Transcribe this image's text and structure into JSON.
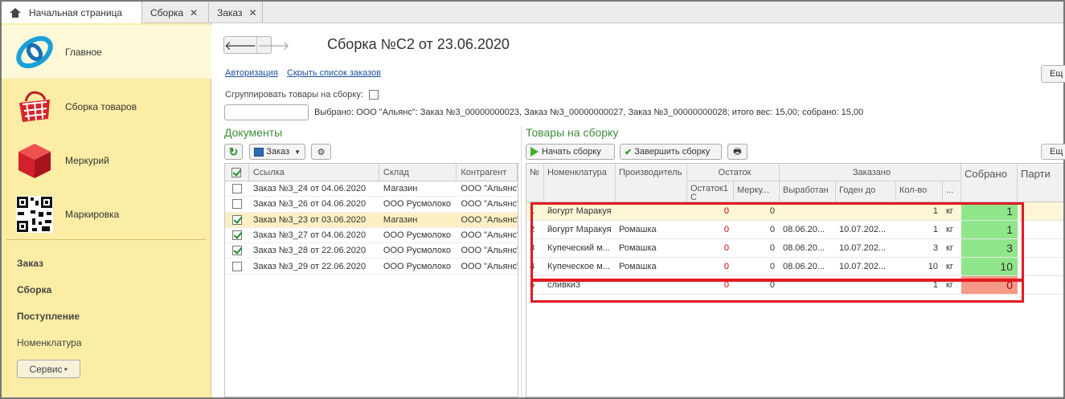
{
  "tabs": [
    {
      "label": "Начальная страница",
      "closable": false
    },
    {
      "label": "Сборка",
      "closable": true
    },
    {
      "label": "Заказ",
      "closable": true
    }
  ],
  "sidebar": {
    "items": [
      {
        "label": "Главное",
        "icon": "logo-icon"
      },
      {
        "label": "Сборка товаров",
        "icon": "basket-icon"
      },
      {
        "label": "Меркурий",
        "icon": "cube-icon"
      },
      {
        "label": "Маркировка",
        "icon": "qr-code-icon"
      }
    ],
    "links": [
      "Заказ",
      "Сборка",
      "Поступление",
      "Номенклатура"
    ],
    "service_label": "Сервис"
  },
  "header": {
    "title": "Сборка №С2 от 23.06.2020",
    "link_auth": "Авторизация",
    "link_hide": "Скрыть список  заказов",
    "more_label": "Ещ",
    "group_label": "Сгруппировать товары на сборку:",
    "selected_info": "Выбрано:  ООО \"Альянс\": Заказ №3_00000000023, Заказ №3_00000000027, Заказ №3_00000000028; итого вес: 15,00; собрано: 15,00"
  },
  "documents": {
    "title": "Документы",
    "order_btn": "Заказ",
    "columns": [
      "Ссылка",
      "Склад",
      "Контрагент"
    ],
    "rows": [
      {
        "checked": false,
        "link": "Заказ №3_24 от 04.06.2020",
        "warehouse": "Магазин",
        "contractor": "ООО \"Альянс\""
      },
      {
        "checked": false,
        "link": "Заказ №3_26 от 04.06.2020",
        "warehouse": "ООО Русмолоко",
        "contractor": "ООО \"Альянс\""
      },
      {
        "checked": true,
        "link": "Заказ №3_23 от 03.06.2020",
        "warehouse": "Магазин",
        "contractor": "ООО \"Альянс\""
      },
      {
        "checked": true,
        "link": "Заказ №3_27 от 04.06.2020",
        "warehouse": "ООО Русмолоко",
        "contractor": "ООО \"Альянс\""
      },
      {
        "checked": true,
        "link": "Заказ №3_28 от 22.06.2020",
        "warehouse": "ООО Русмолоко",
        "contractor": "ООО \"Альянс\""
      },
      {
        "checked": false,
        "link": "Заказ №3_29 от 22.06.2020",
        "warehouse": "ООО Русмолоко",
        "contractor": "ООО \"Альянс\""
      }
    ]
  },
  "goods": {
    "title": "Товары на сборку",
    "start_btn": "Начать  сборку",
    "finish_btn": "Завершить  сборку",
    "more_label": "Ещ",
    "headers": {
      "num": "№",
      "nom": "Номенклатура",
      "producer": "Производитель",
      "balance_group": "Остаток",
      "balance1": "Остаток1 С",
      "mercury": "Мерку...",
      "ordered_group": "Заказано",
      "produced": "Выработан",
      "valid": "Годен до",
      "qty": "Кол-во",
      "unit": "...",
      "collected": "Собрано",
      "batch": "Парти"
    },
    "rows": [
      {
        "n": "1",
        "name": "йогурт Маракуя",
        "producer": "",
        "bal": "0",
        "merc": "0",
        "produced": "",
        "valid": "",
        "qty": "1",
        "unit": "кг",
        "collected": "1",
        "status": "ok"
      },
      {
        "n": "2",
        "name": "йогурт Маракуя",
        "producer": "Ромашка",
        "bal": "0",
        "merc": "0",
        "produced": "08.06.20...",
        "valid": "10.07.202...",
        "qty": "1",
        "unit": "кг",
        "collected": "1",
        "status": "ok"
      },
      {
        "n": "3",
        "name": "Купеческий м...",
        "producer": "Ромашка",
        "bal": "0",
        "merc": "0",
        "produced": "08.06.20...",
        "valid": "10.07.202...",
        "qty": "3",
        "unit": "кг",
        "collected": "3",
        "status": "ok"
      },
      {
        "n": "4",
        "name": "Купеческое м...",
        "producer": "Ромашка",
        "bal": "0",
        "merc": "0",
        "produced": "08.06.20...",
        "valid": "10.07.202...",
        "qty": "10",
        "unit": "кг",
        "collected": "10",
        "status": "ok"
      },
      {
        "n": "5",
        "name": "сливки3",
        "producer": "",
        "bal": "0",
        "merc": "0",
        "produced": "",
        "valid": "",
        "qty": "1",
        "unit": "кг",
        "collected": "0",
        "status": "missing"
      }
    ]
  },
  "colors": {
    "sidebar_bg": "#fbeda5",
    "collected_ok": "#8fe68a",
    "collected_missing": "#f49a86",
    "highlight": "#e11a22",
    "section_title": "#3e8e3a"
  }
}
